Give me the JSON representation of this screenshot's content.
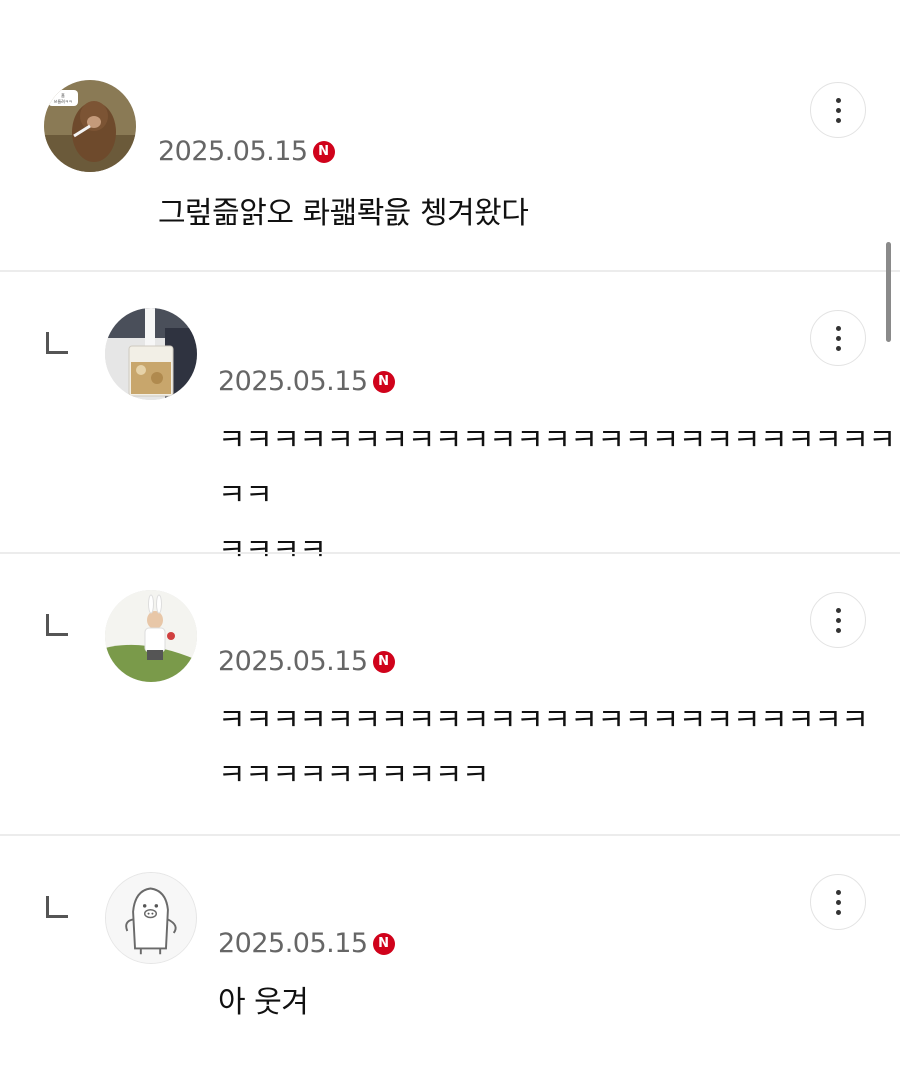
{
  "comments": [
    {
      "date": "2025.05.15",
      "badge": "N",
      "text": "그렆즒앍오 롸괣롹읈 쳉겨왔다",
      "avatar_icon": "monkey-smoking-avatar",
      "avatar_caption": "흠\n쓰들려ㅋㅋ"
    },
    {
      "date": "2025.05.15",
      "badge": "N",
      "text": "ㅋㅋㅋㅋㅋㅋㅋㅋㅋㅋㅋㅋㅋㅋㅋㅋㅋㅋㅋㅋㅋㅋㅋㅋㅋㅋㅋ\nㅋㅋㅋㅋ",
      "avatar_icon": "milk-glass-avatar",
      "reply": true
    },
    {
      "date": "2025.05.15",
      "badge": "N",
      "text": "ㅋㅋㅋㅋㅋㅋㅋㅋㅋㅋㅋㅋㅋㅋㅋㅋㅋㅋㅋㅋㅋㅋㅋㅋ\nㅋㅋㅋㅋㅋㅋㅋㅋㅋㅋ",
      "avatar_icon": "bunny-ears-person-avatar",
      "reply": true
    },
    {
      "date": "2025.05.15",
      "badge": "N",
      "text": "아 웃겨",
      "avatar_icon": "pig-doodle-avatar",
      "reply": true
    }
  ],
  "colors": {
    "badge": "#d0021b",
    "date": "#666666",
    "divider": "#ececec"
  }
}
